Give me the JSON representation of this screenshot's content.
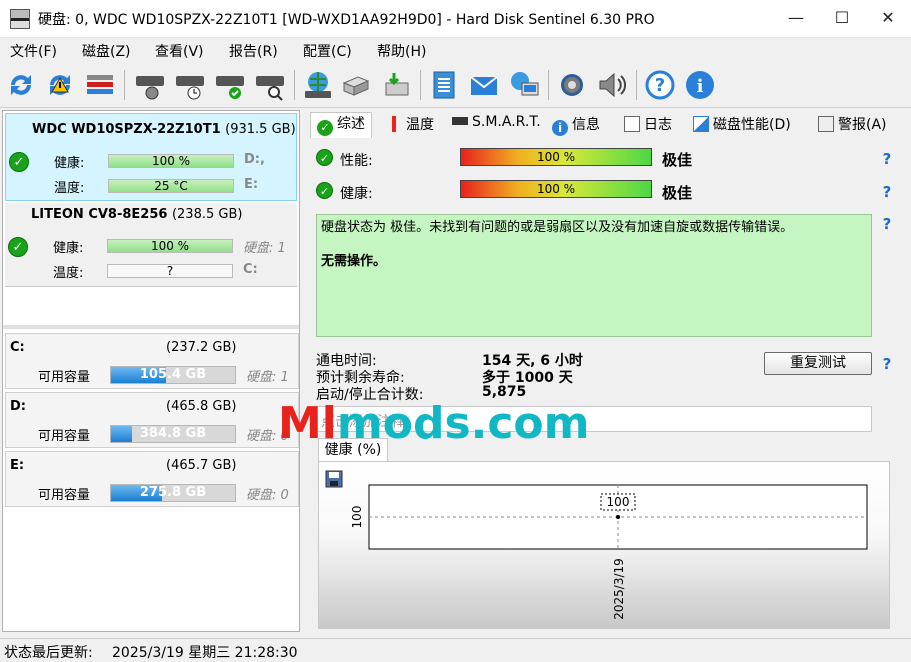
{
  "window": {
    "title": "硬盘:  0, WDC WD10SPZX-22Z10T1 [WD-WXD1AA92H9D0]  -  Hard Disk Sentinel 6.30 PRO",
    "minimize": "—",
    "maximize": "☐",
    "close": "✕"
  },
  "menu": {
    "items": [
      "文件(F)",
      "磁盘(Z)",
      "查看(V)",
      "报告(R)",
      "配置(C)",
      "帮助(H)"
    ]
  },
  "toolbar": {
    "icons": [
      "refresh-icon",
      "refresh-warning-icon",
      "disk-list-icon",
      "disk-surface-icon",
      "disk-clock-icon",
      "disk-check-icon",
      "disk-search-icon",
      "globe-disk-icon",
      "network-drive-icon",
      "drive-down-icon",
      "notepad-icon",
      "mail-icon",
      "network-monitor-icon",
      "gear-icon",
      "speaker-icon",
      "help-icon",
      "info-icon"
    ]
  },
  "disks": [
    {
      "name": "WDC WD10SPZX-22Z10T1",
      "size": "(931.5 GB)",
      "health_label": "健康:",
      "health_value": "100 %",
      "health_pct": 100,
      "temp_label": "温度:",
      "temp_value": "25 °C",
      "drives_line1": "D:,",
      "drives_line2": "E:"
    },
    {
      "name": "LITEON CV8-8E256",
      "size": "(238.5 GB)",
      "health_label": "健康:",
      "health_value": "100 %",
      "health_pct": 100,
      "temp_label": "温度:",
      "temp_value": "?",
      "drives_line1": "硬盘: 1",
      "drives_line2": "C:"
    }
  ],
  "partitions": [
    {
      "letter": "C:",
      "size": "(237.2 GB)",
      "free_label": "可用容量",
      "free": "105.4 GB",
      "free_pct": 44,
      "disk": "硬盘: 1"
    },
    {
      "letter": "D:",
      "size": "(465.8 GB)",
      "free_label": "可用容量",
      "free": "384.8 GB",
      "free_pct": 17,
      "disk": "硬盘: 0"
    },
    {
      "letter": "E:",
      "size": "(465.7 GB)",
      "free_label": "可用容量",
      "free": "275.8 GB",
      "free_pct": 41,
      "disk": "硬盘: 0"
    }
  ],
  "tabs": [
    "综述",
    "温度",
    "S.M.A.R.T.",
    "信息",
    "日志",
    "磁盘性能(D)",
    "警报(A)"
  ],
  "overview": {
    "perf_label": "性能:",
    "perf_value": "100 %",
    "perf_rating": "极佳",
    "health_label": "健康:",
    "health_value": "100 %",
    "health_rating": "极佳",
    "status_text": "硬盘状态为 极佳。未找到有问题的或是弱扇区以及没有加速自旋或数据传输错误。",
    "action_text": "无需操作。",
    "power_on_label": "通电时间:",
    "power_on_value": "154 天, 6 小时",
    "remaining_label": "预计剩余寿命:",
    "remaining_value": "多于 1000 天",
    "startstop_label": "启动/停止合计数:",
    "startstop_value": "5,875",
    "retest_button": "重复测试",
    "note_placeholder": "点击添加注释",
    "health_tab": "健康 (%)",
    "help_glyph": "?"
  },
  "chart_data": {
    "type": "line",
    "x": [
      "2025/3/19"
    ],
    "series": [
      {
        "values": [
          100
        ]
      }
    ],
    "ylabel": "",
    "y_tick": "100",
    "point_label": "100",
    "x_tick": "2025/3/19"
  },
  "statusbar": {
    "label": "状态最后更新:",
    "value": "2025/3/19 星期三 21:28:30"
  },
  "watermark": {
    "text": "Mlmods.com",
    "part1": "Ml",
    "part2": "mods.com"
  },
  "colors": {
    "accent_blue": "#1a7fd4",
    "health_green": "#19a319",
    "status_box": "#c5f5c0",
    "watermark": "#10b8c6"
  }
}
